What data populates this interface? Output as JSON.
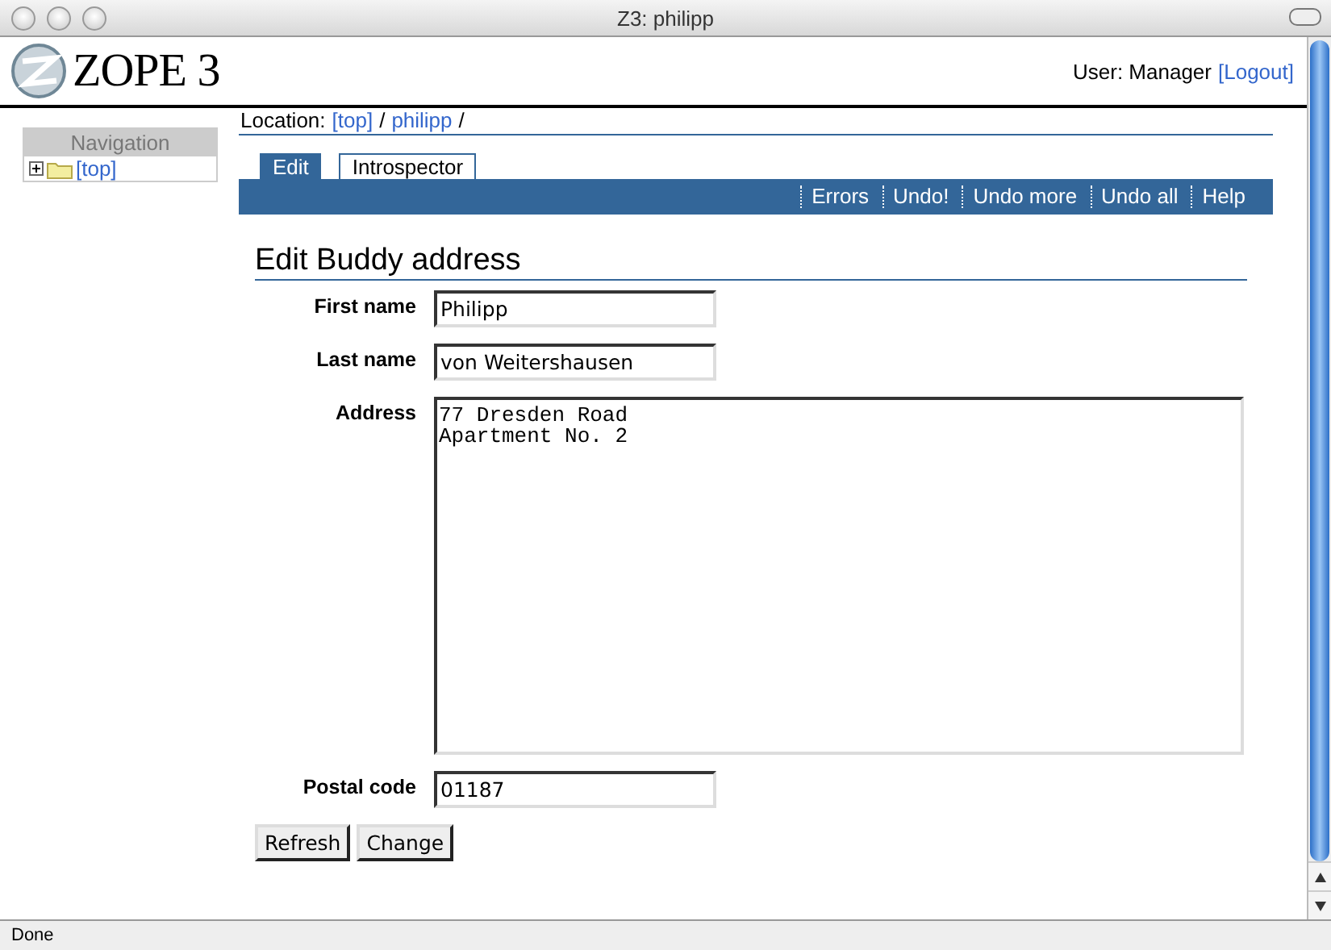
{
  "window": {
    "title": "Z3: philipp"
  },
  "header": {
    "logo": "ZOPE 3",
    "user": "User: Manager",
    "logout": "[Logout]"
  },
  "navigation": {
    "title": "Navigation",
    "items": [
      {
        "label": "[top]",
        "expanded": false
      }
    ]
  },
  "location": {
    "label": "Location:",
    "links": [
      "[top]",
      "philipp"
    ],
    "separator": "/"
  },
  "tabs": [
    {
      "label": "Edit",
      "selected": true
    },
    {
      "label": "Introspector",
      "selected": false
    }
  ],
  "actions": [
    "Errors",
    "Undo!",
    "Undo more",
    "Undo all",
    "Help"
  ],
  "form": {
    "title": "Edit Buddy address",
    "fields": [
      {
        "kind": "text",
        "label": "First name",
        "value": "Philipp"
      },
      {
        "kind": "text",
        "label": "Last name",
        "value": "von Weitershausen"
      },
      {
        "kind": "textarea",
        "label": "Address",
        "value": "77 Dresden Road\nApartment No. 2"
      },
      {
        "kind": "text",
        "label": "Postal code",
        "value": "01187"
      }
    ],
    "buttons": [
      "Refresh",
      "Change"
    ]
  },
  "status_bar": {
    "text": "Done"
  }
}
